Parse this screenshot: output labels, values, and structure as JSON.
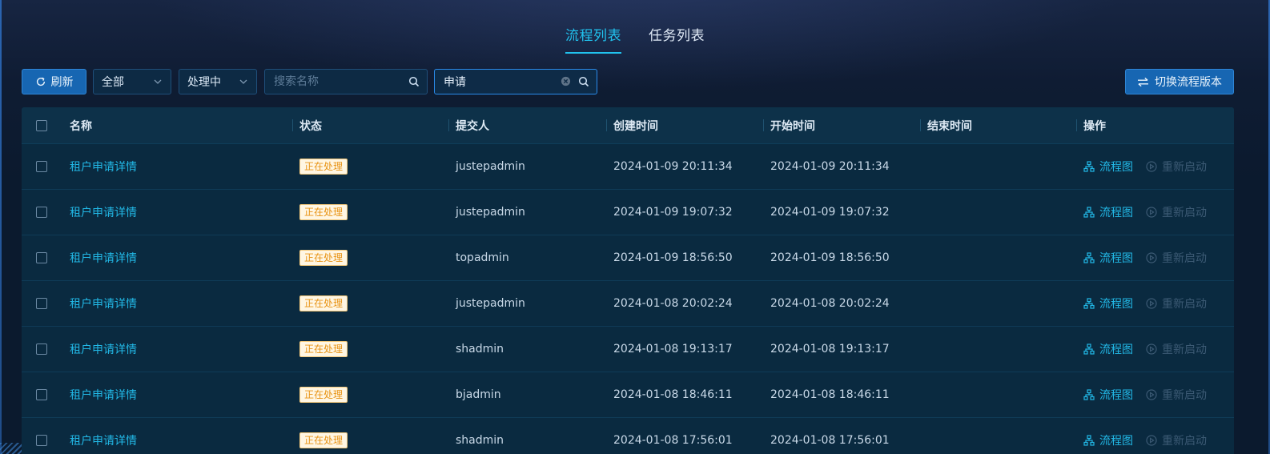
{
  "tabs": [
    {
      "label": "流程列表",
      "active": true
    },
    {
      "label": "任务列表",
      "active": false
    }
  ],
  "toolbar": {
    "refresh_label": "刷新",
    "filter_all": "全部",
    "filter_status": "处理中",
    "search_name_placeholder": "搜索名称",
    "search_value": "申请",
    "switch_version_label": "切换流程版本"
  },
  "table": {
    "headers": {
      "name": "名称",
      "status": "状态",
      "submitter": "提交人",
      "created": "创建时间",
      "start": "开始时间",
      "end": "结束时间",
      "actions": "操作"
    },
    "rows": [
      {
        "name": "租户申请详情",
        "status": "正在处理",
        "submitter": "justepadmin",
        "created": "2024-01-09 20:11:34",
        "start": "2024-01-09 20:11:34",
        "end": "",
        "op_flow": "流程图",
        "op_restart": "重新启动"
      },
      {
        "name": "租户申请详情",
        "status": "正在处理",
        "submitter": "justepadmin",
        "created": "2024-01-09 19:07:32",
        "start": "2024-01-09 19:07:32",
        "end": "",
        "op_flow": "流程图",
        "op_restart": "重新启动"
      },
      {
        "name": "租户申请详情",
        "status": "正在处理",
        "submitter": "topadmin",
        "created": "2024-01-09 18:56:50",
        "start": "2024-01-09 18:56:50",
        "end": "",
        "op_flow": "流程图",
        "op_restart": "重新启动"
      },
      {
        "name": "租户申请详情",
        "status": "正在处理",
        "submitter": "justepadmin",
        "created": "2024-01-08 20:02:24",
        "start": "2024-01-08 20:02:24",
        "end": "",
        "op_flow": "流程图",
        "op_restart": "重新启动"
      },
      {
        "name": "租户申请详情",
        "status": "正在处理",
        "submitter": "shadmin",
        "created": "2024-01-08 19:13:17",
        "start": "2024-01-08 19:13:17",
        "end": "",
        "op_flow": "流程图",
        "op_restart": "重新启动"
      },
      {
        "name": "租户申请详情",
        "status": "正在处理",
        "submitter": "bjadmin",
        "created": "2024-01-08 18:46:11",
        "start": "2024-01-08 18:46:11",
        "end": "",
        "op_flow": "流程图",
        "op_restart": "重新启动"
      },
      {
        "name": "租户申请详情",
        "status": "正在处理",
        "submitter": "shadmin",
        "created": "2024-01-08 17:56:01",
        "start": "2024-01-08 17:56:01",
        "end": "",
        "op_flow": "流程图",
        "op_restart": "重新启动"
      }
    ]
  },
  "icons": {
    "refresh": "refresh-icon",
    "chevron": "chevron-down-icon",
    "search": "search-icon",
    "clear": "clear-icon",
    "switch": "swap-icon",
    "flow": "flowchart-icon",
    "restart": "play-circle-icon"
  },
  "colors": {
    "accent": "#21c2ee",
    "primary_button": "#1766b2",
    "badge_text": "#e89314",
    "badge_bg": "#fff6e3",
    "disabled_action": "#3c5a74"
  }
}
